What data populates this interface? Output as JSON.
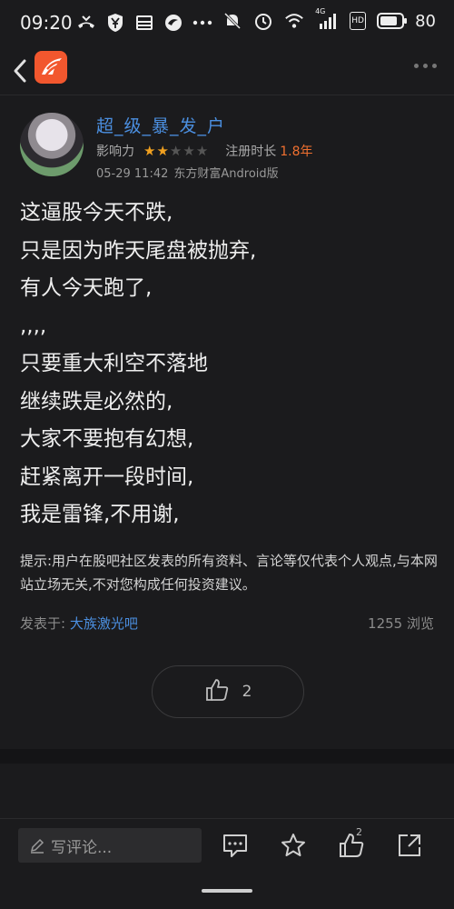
{
  "status_bar": {
    "time": "09:20",
    "left_icons": [
      "missed-call-icon",
      "yen-shield-icon",
      "news-icon",
      "swirl-app-icon",
      "more-dots-icon"
    ],
    "right_icons": [
      "silent-bell-icon",
      "alarm-icon",
      "wifi-icon",
      "signal-4g-icon",
      "hd-icon",
      "battery-icon"
    ],
    "signal_label": "4G",
    "hd_label": "HD",
    "battery_level": "80"
  },
  "nav": {
    "back_icon": "chevron-left-icon",
    "logo_icon": "eastmoney-logo-icon",
    "more_icon": "more-dots-icon"
  },
  "author": {
    "username": "超_级_暴_发_户",
    "influence_label": "影响力",
    "stars_filled": 2,
    "stars_total": 5,
    "reg_label": "注册时长",
    "reg_value": "1.8年",
    "post_time": "05-29 11:42",
    "platform": "东方财富Android版"
  },
  "post": {
    "lines": [
      "这逼股今天不跌,",
      "只是因为昨天尾盘被抛弃,",
      "有人今天跑了,",
      ",,,,",
      "只要重大利空不落地",
      "继续跌是必然的,",
      "大家不要抱有幻想,",
      "赶紧离开一段时间,",
      "我是雷锋,不用谢,"
    ]
  },
  "disclaimer": "提示:用户在股吧社区发表的所有资料、言论等仅代表个人观点,与本网站立场无关,不对您构成任何投资建议。",
  "source": {
    "posted_in_label": "发表于:",
    "bar_name": "大族激光吧",
    "views": "1255 浏览"
  },
  "like": {
    "icon": "thumbs-up-icon",
    "count": "2"
  },
  "bottom_bar": {
    "comment_placeholder": "写评论...",
    "comment_icon": "comment-icon",
    "favorite_icon": "star-icon",
    "like_icon": "thumbs-up-icon",
    "like_badge": "2",
    "share_icon": "share-icon"
  },
  "colors": {
    "background": "#1b1b1d",
    "link": "#4b8fe0",
    "accent_orange": "#f07030",
    "star": "#f0a020",
    "logo": "#f2572e"
  }
}
